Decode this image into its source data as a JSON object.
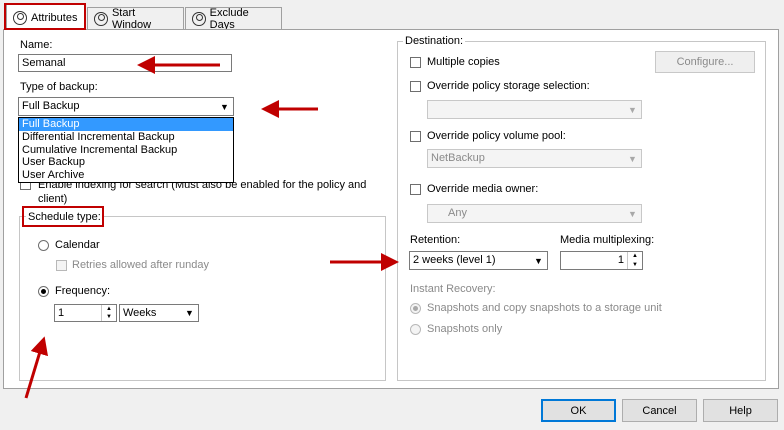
{
  "tabs": [
    {
      "label": "Attributes",
      "icon": "schedule-icon",
      "active": true
    },
    {
      "label": "Start Window",
      "icon": "clock-icon"
    },
    {
      "label": "Exclude Days",
      "icon": "calendar-icon"
    }
  ],
  "left": {
    "name_label": "Name:",
    "name_value": "Semanal",
    "type_label": "Type of backup:",
    "type_value": "Full Backup",
    "type_options": [
      "Full Backup",
      "Differential Incremental Backup",
      "Cumulative Incremental Backup",
      "User Backup",
      "User Archive"
    ],
    "indexing_label_line1": "Enable indexing for search (Must also be enabled for the policy and",
    "indexing_label_line2": "client)",
    "schedule_type_label": "Schedule type:",
    "calendar_label": "Calendar",
    "retries_label": "Retries allowed after runday",
    "frequency_label": "Frequency:",
    "frequency_value": "1",
    "frequency_unit": "Weeks"
  },
  "destination": {
    "group_label": "Destination:",
    "multiple_copies_label": "Multiple copies",
    "configure_label": "Configure...",
    "override_storage_label": "Override policy storage selection:",
    "storage_value": "",
    "override_pool_label": "Override policy volume pool:",
    "pool_value": "NetBackup",
    "override_owner_label": "Override media owner:",
    "owner_value": "Any",
    "retention_label": "Retention:",
    "retention_value": "2 weeks (level 1)",
    "multiplexing_label": "Media multiplexing:",
    "multiplexing_value": "1",
    "instant_recovery_label": "Instant Recovery:",
    "snap_copy_label": "Snapshots and copy snapshots to a storage unit",
    "snap_only_label": "Snapshots only"
  },
  "buttons": {
    "ok": "OK",
    "cancel": "Cancel",
    "help": "Help"
  },
  "colors": {
    "annotation_red": "#c00000",
    "selection_blue": "#3399ff"
  }
}
